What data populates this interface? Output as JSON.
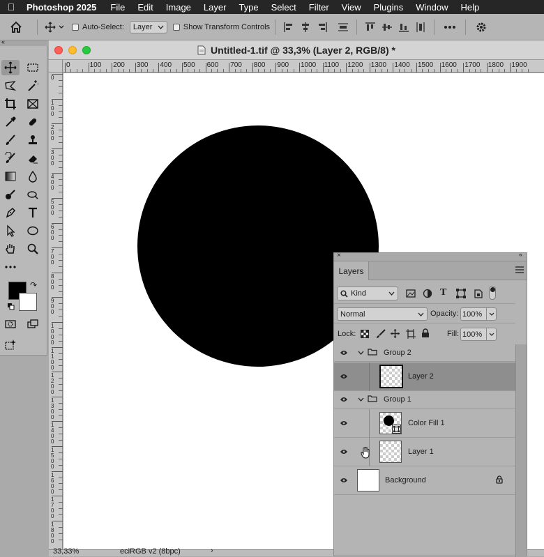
{
  "menubar": {
    "app": "Photoshop 2025",
    "items": [
      "File",
      "Edit",
      "Image",
      "Layer",
      "Type",
      "Select",
      "Filter",
      "View",
      "Plugins",
      "Window",
      "Help"
    ]
  },
  "options": {
    "auto_select_label": "Auto-Select:",
    "auto_select_value": "Layer",
    "show_transform": "Show Transform Controls"
  },
  "document": {
    "title": "Untitled-1.tif @ 33,3% (Layer 2, RGB/8) *",
    "zoom": "33,33%",
    "profile": "eciRGB v2 (8bpc)"
  },
  "ruler": {
    "h_ticks": [
      "0",
      "100",
      "200",
      "300",
      "400",
      "500",
      "600",
      "700",
      "800",
      "900",
      "1000",
      "1100",
      "1200",
      "1300",
      "1400",
      "1500",
      "1600",
      "1700",
      "1800",
      "1900"
    ],
    "v_ticks": [
      "0",
      "1\n0\n0",
      "2\n0\n0",
      "3\n0\n0",
      "4\n0\n0",
      "5\n0\n0",
      "6\n0\n0",
      "7\n0\n0",
      "8\n0\n0",
      "9\n0\n0",
      "1\n0\n0\n0",
      "1\n1\n0\n0",
      "1\n2\n0\n0",
      "1\n3\n0\n0",
      "1\n4\n0\n0",
      "1\n5\n0\n0",
      "1\n6\n0\n0",
      "1\n7\n0\n0",
      "1\n8\n0\n0"
    ]
  },
  "layers_panel": {
    "tab": "Layers",
    "filter_kind": "Kind",
    "blend_mode": "Normal",
    "opacity_label": "Opacity:",
    "opacity": "100%",
    "lock_label": "Lock:",
    "fill_label": "Fill:",
    "fill": "100%",
    "rows": [
      {
        "name": "Group 2"
      },
      {
        "name": "Layer 2"
      },
      {
        "name": "Group 1"
      },
      {
        "name": "Color Fill 1"
      },
      {
        "name": "Layer 1"
      },
      {
        "name": "Background"
      }
    ]
  }
}
